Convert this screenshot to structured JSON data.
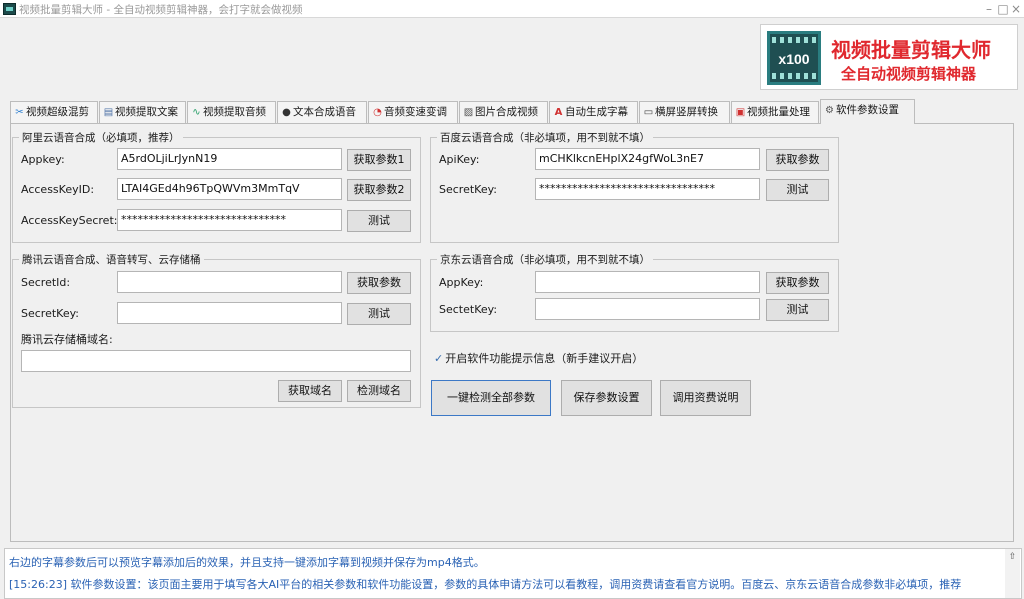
{
  "window": {
    "title": "视频批量剪辑大师 - 全自动视频剪辑神器，会打字就会做视频",
    "minimize": "–",
    "maximize": "□",
    "close": "×"
  },
  "banner": {
    "logo_text": "x100",
    "title": "视频批量剪辑大师",
    "subtitle": "全自动视频剪辑神器",
    "color": "#e0282e"
  },
  "tabs": [
    {
      "label": "视频超级混剪",
      "icon": "scissors-icon",
      "glyph": "✂"
    },
    {
      "label": "视频提取文案",
      "icon": "document-icon",
      "glyph": "▤"
    },
    {
      "label": "视频提取音频",
      "icon": "audio-wave-icon",
      "glyph": "∿"
    },
    {
      "label": "文本合成语音",
      "icon": "microphone-icon",
      "glyph": "●"
    },
    {
      "label": "音频变速变调",
      "icon": "speed-gauge-icon",
      "glyph": "◔"
    },
    {
      "label": "图片合成视频",
      "icon": "image-icon",
      "glyph": "▨"
    },
    {
      "label": "自动生成字幕",
      "icon": "font-icon",
      "glyph": "A"
    },
    {
      "label": "横屏竖屏转换",
      "icon": "rotate-screen-icon",
      "glyph": "▭"
    },
    {
      "label": "视频批量处理",
      "icon": "film-icon",
      "glyph": "▣"
    },
    {
      "label": "软件参数设置",
      "icon": "gear-icon",
      "glyph": "⚙"
    }
  ],
  "aliyun": {
    "title": "阿里云语音合成（必填项，推荐）",
    "appkey_label": "Appkey:",
    "appkey_value": "A5rdOLjiLrJynN19",
    "appkey_btn": "获取参数1",
    "accesskeyid_label": "AccessKeyID:",
    "accesskeyid_value": "LTAI4GEd4h96TpQWVm3MmTqV",
    "accesskeyid_btn": "获取参数2",
    "secret_label": "AccessKeySecret:",
    "secret_value": "******************************",
    "test_btn": "测试"
  },
  "baidu": {
    "title": "百度云语音合成（非必填项，用不到就不填）",
    "apikey_label": "ApiKey:",
    "apikey_value": "mCHKlkcnEHplX24gfWoL3nE7",
    "apikey_btn": "获取参数",
    "secret_label": "SecretKey:",
    "secret_value": "********************************",
    "test_btn": "测试"
  },
  "tencent": {
    "title": "腾讯云语音合成、语音转写、云存储桶",
    "secretid_label": "SecretId:",
    "secretid_value": "",
    "secretid_btn": "获取参数",
    "secretkey_label": "SecretKey:",
    "secretkey_value": "",
    "test_btn": "测试",
    "bucket_label": "腾讯云存储桶域名:",
    "bucket_value": "",
    "get_domain_btn": "获取域名",
    "check_domain_btn": "检测域名"
  },
  "jd": {
    "title": "京东云语音合成（非必填项，用不到就不填）",
    "appkey_label": "AppKey:",
    "appkey_value": "",
    "appkey_btn": "获取参数",
    "secret_label": "SectetKey:",
    "secret_value": "",
    "test_btn": "测试"
  },
  "options": {
    "tips_checkbox_label": "开启软件功能提示信息（新手建议开启）",
    "tips_checked": true
  },
  "actions": {
    "check_all": "一键检测全部参数",
    "save": "保存参数设置",
    "pricing": "调用资费说明"
  },
  "log": {
    "line1": "右边的字幕参数后可以预览字幕添加后的效果，并且支持一键添加字幕到视频并保存为mp4格式。",
    "line2": "[15:26:23] 软件参数设置：该页面主要用于填写各大AI平台的相关参数和软件功能设置，参数的具体申请方法可以看教程，调用资费请查看官方说明。百度云、京东云语音合成参数非必填项，推荐",
    "color": "#2a62b4"
  }
}
